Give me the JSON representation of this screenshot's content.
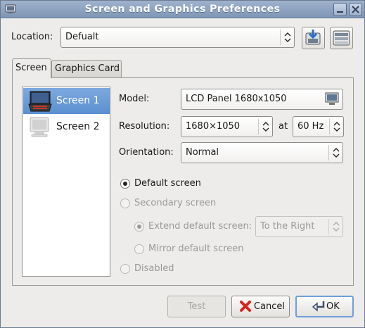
{
  "window": {
    "title": "Screen and Graphics Preferences"
  },
  "location": {
    "label": "Location:",
    "value": "Defualt"
  },
  "tabs": [
    {
      "label": "Screen"
    },
    {
      "label": "Graphics Card"
    }
  ],
  "screens": [
    {
      "label": "Screen 1",
      "selected": true,
      "icon": "monitor-lcd-icon"
    },
    {
      "label": "Screen 2",
      "selected": false,
      "icon": "monitor-crt-icon"
    }
  ],
  "model": {
    "label": "Model:",
    "value": "LCD Panel 1680x1050"
  },
  "resolution": {
    "label": "Resolution:",
    "value": "1680×1050",
    "at_label": "at",
    "refresh": "60 Hz"
  },
  "orientation": {
    "label": "Orientation:",
    "value": "Normal"
  },
  "radios": {
    "default_screen": "Default screen",
    "secondary_screen": "Secondary screen",
    "extend_default": "Extend default screen:",
    "extend_position": "To the Right",
    "mirror_default": "Mirror default screen",
    "disabled": "Disabled"
  },
  "buttons": {
    "test": "Test",
    "cancel": "Cancel",
    "ok": "OK"
  },
  "colors": {
    "titlebar": "#8da2c1",
    "selection": "#5a8fd0",
    "cancel_icon": "#d8241c"
  }
}
